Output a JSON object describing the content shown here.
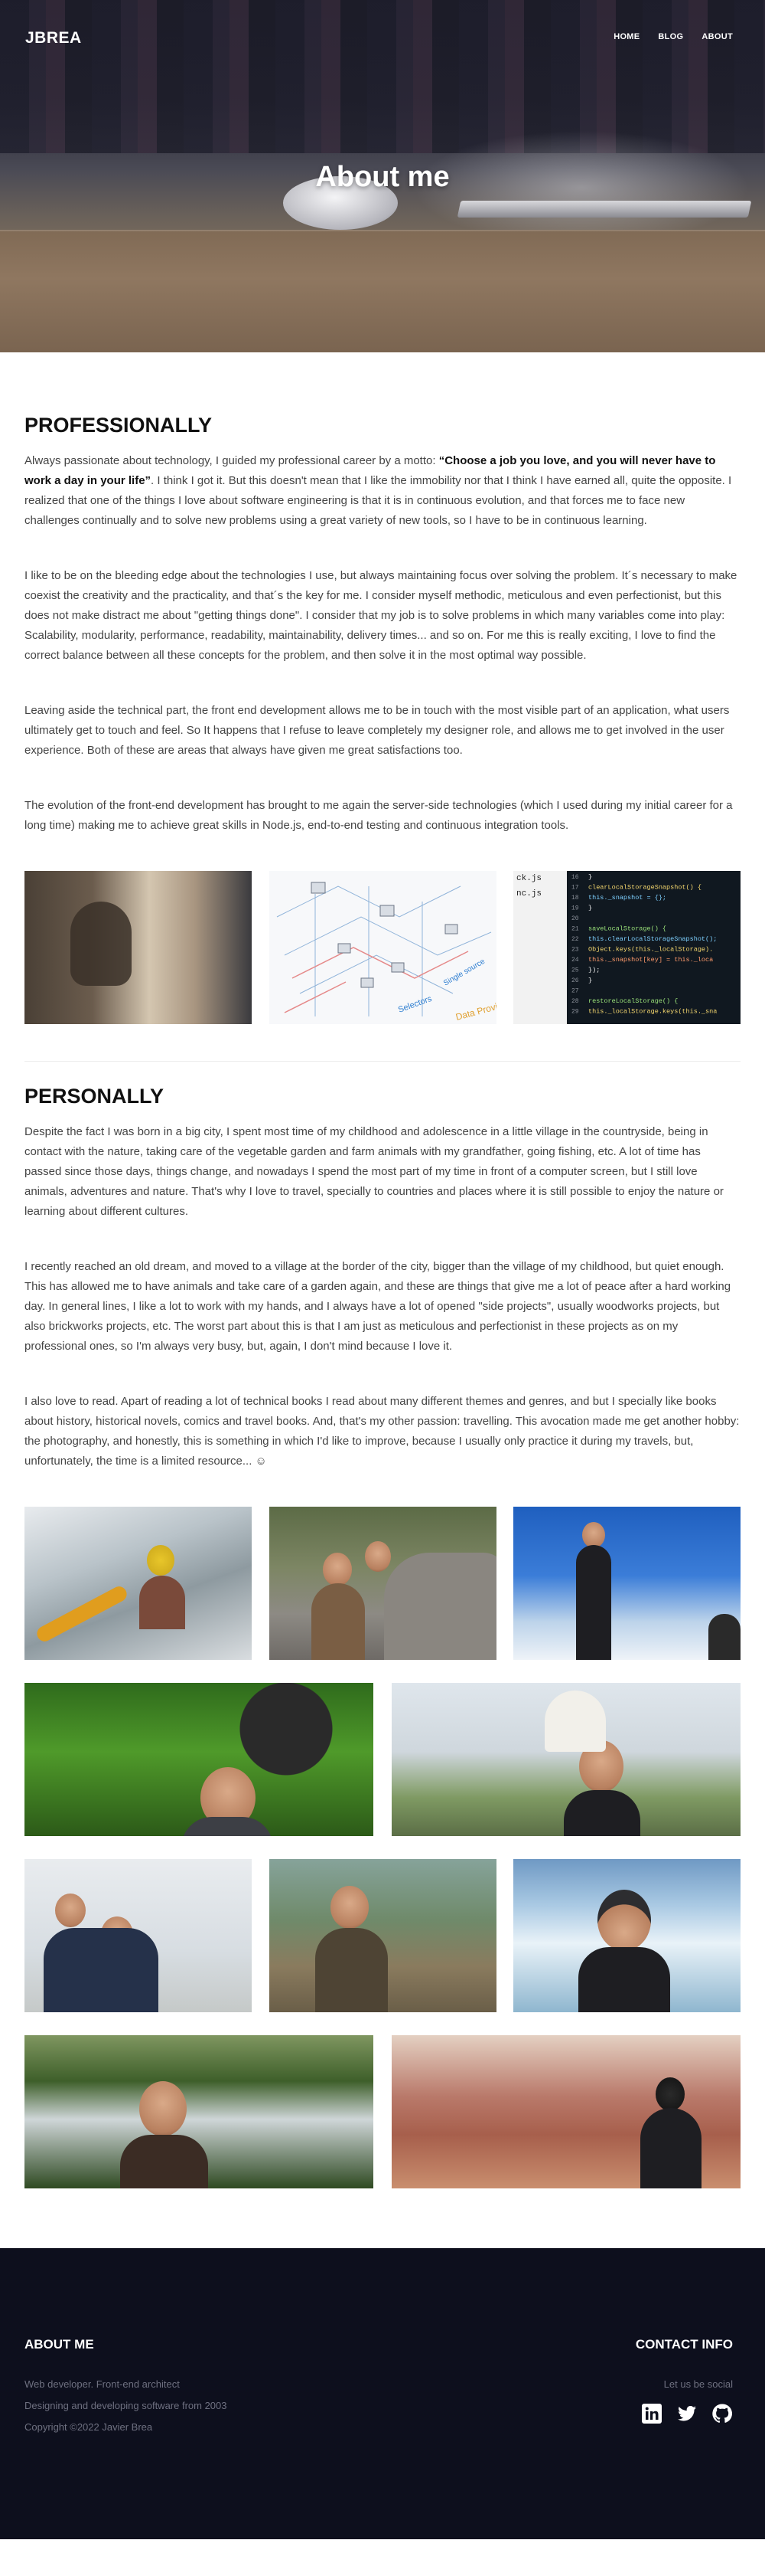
{
  "nav": {
    "logo": "JBREA",
    "items": [
      "HOME",
      "BLOG",
      "ABOUT"
    ]
  },
  "hero": {
    "title": "About me"
  },
  "professionally": {
    "title": "PROFESSIONALLY",
    "p1_before": "Always passionate about technology, I guided my professional career by a motto: ",
    "p1_bold": "“Choose a job you love, and you will never have to work a day in your life”",
    "p1_after": ". I think I got it. But this doesn't mean that I like the immobility nor that I think I have earned all, quite the opposite. I realized that one of the things I love about software engineering is that it is in continuous evolution, and that forces me to face new challenges continually and to solve new problems using a great variety of new tools, so I have to be in continuous learning.",
    "p2": "I like to be on the bleeding edge about the technologies I use, but always maintaining focus over solving the problem. It´s necessary to make coexist the creativity and the practicality, and that´s the key for me. I consider myself methodic, meticulous and even perfectionist, but this does not make distract me about \"getting things done\". I consider that my job is to solve problems in which many variables come into play: Scalability, modularity, performance, readability, maintainability, delivery times... and so on. For me this is really exciting, I love to find the correct balance between all these concepts for the problem, and then solve it in the most optimal way possible.",
    "p3": "Leaving aside the technical part, the front end development allows me to be in touch with the most visible part of an application, what users ultimately get to touch and feel. So It happens that I refuse to leave completely my designer role, and allows me to get involved in the user experience. Both of these are areas that always have given me great satisfactions too.",
    "p4": "The evolution of the front-end development has brought to me again the server-side technologies (which I used during my initial career for a long time) making me to achieve great skills in Node.js, end-to-end testing and continuous integration tools.",
    "diagram_labels": [
      "Selectors",
      "Single source",
      "Data Provi"
    ],
    "code_files": [
      "ck.js",
      "nc.js"
    ],
    "code_lines": [
      "16",
      "17",
      "18",
      "19",
      "20",
      "21",
      "22",
      "23",
      "24",
      "25",
      "26",
      "27",
      "28",
      "29"
    ],
    "code_text": [
      "}",
      "clearLocalStorageSnapshot() {",
      "  this._snapshot = {};",
      "}",
      "",
      "saveLocalStorage() {",
      "  this.clearLocalStorageSnapshot();",
      "  Object.keys(this._localStorage).",
      "    this._snapshot[key] = this._loca",
      "  });",
      "}",
      "",
      "restoreLocalStorage() {",
      "  this._localStorage.keys(this._sna"
    ]
  },
  "personally": {
    "title": "PERSONALLY",
    "p1": "Despite the fact I was born in a big city, I spent most time of my childhood and adolescence in a little village in the countryside, being in contact with the nature, taking care of the vegetable garden and farm animals with my grandfather, going fishing, etc. A lot of time has passed since those days, things change, and nowadays I spend the most part of my time in front of a computer screen, but I still love animals, adventures and nature. That's why I love to travel, specially to countries and places where it is still possible to enjoy the nature or learning about different cultures.",
    "p2": "I recently reached an old dream, and moved to a village at the border of the city, bigger than the village of my childhood, but quiet enough. This has allowed me to have animals and take care of a garden again, and these are things that give me a lot of peace after a hard working day. In general lines, I like a lot to work with my hands, and I always have a lot of opened \"side projects\", usually woodworks projects, but also brickworks projects, etc. The worst part about this is that I am just as meticulous and perfectionist in these projects as on my professional ones, so I'm always very busy, but, again, I don't mind because I love it.",
    "p3": "I also love to read. Apart of reading a lot of technical books I read about many different themes and genres, and but I specially like books about history, historical novels, comics and travel books. And, that's my other passion: travelling. This avocation made me get another hobby: the photography, and honestly, this is something in which I'd like to improve, because I usually only practice it during my travels, but, unfortunately, the time is a limited resource... ☺"
  },
  "footer": {
    "about_title": "ABOUT ME",
    "about_lines": [
      "Web developer. Front-end architect",
      "Designing and developing software from 2003",
      "Copyright ©2022 Javier Brea"
    ],
    "contact_title": "CONTACT INFO",
    "contact_subtitle": "Let us be social",
    "socials": [
      "linkedin-icon",
      "twitter-icon",
      "github-icon"
    ]
  }
}
